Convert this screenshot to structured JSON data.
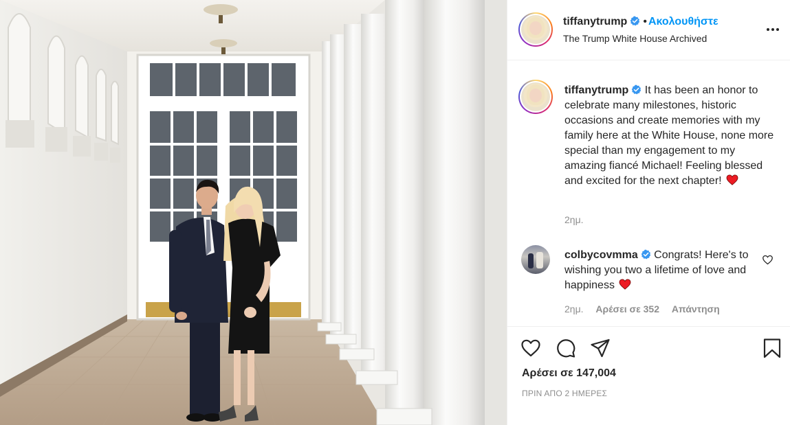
{
  "post": {
    "image_alt": "Couple standing in the White House colonnade",
    "author": {
      "username": "tiffanytrump",
      "verified": true,
      "follow_label": "Ακολουθήστε",
      "subtitle": "The Trump White House Archived"
    },
    "caption": {
      "username": "tiffanytrump",
      "text": "It has been an honor to celebrate many milestones, historic occasions and create memories with my family here at the White House, none more special than my engagement to my amazing fiancé Michael! Feeling blessed and excited for the next chapter!",
      "time": "2ημ."
    },
    "comments": [
      {
        "username": "colbycovmma",
        "verified": true,
        "text": "Congrats! Here's to wishing you two a lifetime of love and happiness",
        "time": "2ημ.",
        "likes": "Αρέσει σε 352",
        "reply_label": "Απάντηση"
      }
    ],
    "likes_label": "Αρέσει σε 147,004",
    "posted_ago": "ΠΡΙΝ ΑΠΟ 2 ΗΜΕΡΕΣ"
  },
  "icons": {
    "more": "more-options-icon",
    "like": "heart-outline-icon",
    "comment": "comment-bubble-icon",
    "share": "paper-plane-icon",
    "save": "bookmark-icon",
    "verified": "verified-badge-icon"
  },
  "colors": {
    "follow": "#0095f6",
    "verified": "#3897f0",
    "heart_emoji": "#ed1c24",
    "secondary_text": "#8e8e8e"
  }
}
